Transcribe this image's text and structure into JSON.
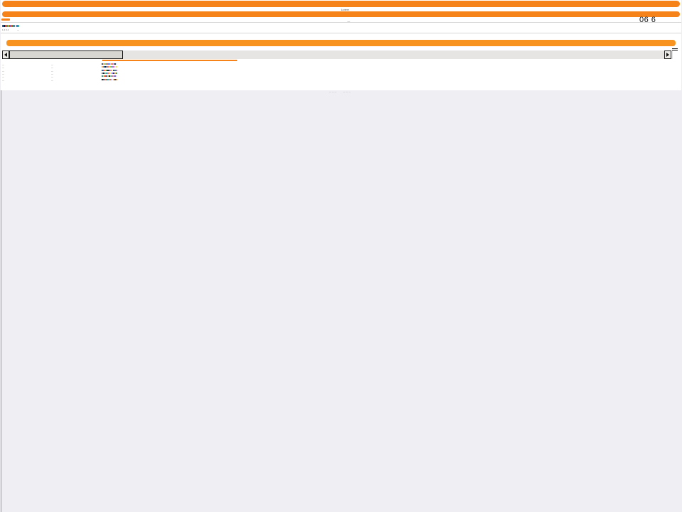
{
  "header": {
    "caption": "Lorem",
    "secondary_caption": "—",
    "corner_value": "06 6"
  },
  "toolbar": {
    "swatch_colors": [
      "#2b6cb0",
      "#1a1a1a",
      "#e53e3e",
      "#38a169",
      "#d69e2e",
      "#805ad5",
      "#dd6b20",
      "#319795",
      "#718096",
      "#e2e8f0",
      "#3182ce",
      "#48bb78"
    ],
    "label_left": "1 2 3 4",
    "label_right": "—"
  },
  "scrollbar": {
    "left_arrow": "left-arrow-icon",
    "right_arrow": "right-arrow-icon"
  },
  "table": {
    "rows": [
      {
        "col1": "—",
        "col2": "—",
        "colors": [
          "#4a5568",
          "#f6ad55",
          "#68d391",
          "#f56565",
          "#4299e1",
          "#9f7aea",
          "#ecc94b",
          "#ed64a6",
          "#a0aec0",
          "#2d3748",
          "#e2e8f0"
        ]
      },
      {
        "col1": "—",
        "col2": "—",
        "colors": [
          "#f6ad55",
          "#4299e1",
          "#1a202c",
          "#718096",
          "#f56565",
          "#ecc94b",
          "#68d391",
          "#9f7aea",
          "#ed64a6",
          "#e2e8f0",
          "#f6e05e"
        ]
      },
      {
        "col1": "—",
        "col2": "—",
        "colors": [
          "#2b6cb0",
          "#e53e3e",
          "#f6ad55",
          "#38a169",
          "#1a202c",
          "#805ad5",
          "#d69e2e",
          "#e2e8f0",
          "#4a5568",
          "#319795",
          "#ed64a6"
        ]
      },
      {
        "col1": "—",
        "col2": "—",
        "colors": [
          "#718096",
          "#1a202c",
          "#68d391",
          "#4299e1",
          "#f56565",
          "#ecc94b",
          "#e2e8f0",
          "#9f7aea",
          "#2d3748",
          "#f6ad55",
          "#38a169"
        ]
      },
      {
        "col1": "—",
        "col2": "—",
        "colors": [
          "#319795",
          "#f6ad55",
          "#e53e3e",
          "#2b6cb0",
          "#ecc94b",
          "#1a202c",
          "#68d391",
          "#ed64a6",
          "#a0aec0",
          "#805ad5",
          "#e2e8f0"
        ]
      },
      {
        "col1": "—",
        "col2": "—",
        "colors": [
          "#1a202c",
          "#4a5568",
          "#f56565",
          "#38a169",
          "#4299e1",
          "#d69e2e",
          "#9f7aea",
          "#e2e8f0",
          "#f6ad55",
          "#2d3748",
          "#ed8936"
        ]
      }
    ]
  },
  "footer": {
    "left_text": "— — —",
    "right_text": "— — —"
  },
  "colors": {
    "accent": "#f6831a",
    "background": "#efeff3",
    "panel": "#ffffff"
  }
}
